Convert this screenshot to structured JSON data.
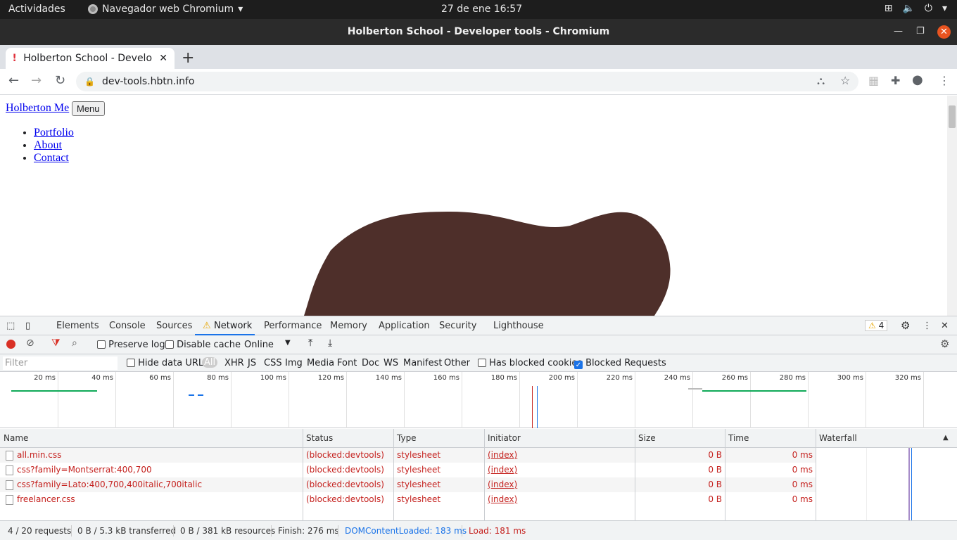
{
  "topbar": {
    "activities": "Actividades",
    "app_menu": "Navegador web Chromium",
    "clock": "27 de ene  16:57"
  },
  "window": {
    "title": "Holberton School - Developer tools - Chromium"
  },
  "browser": {
    "tab_title": "Holberton School - Develo",
    "url": "dev-tools.hbtn.info"
  },
  "page": {
    "brand": "Holberton Me",
    "menu_button": "Menu",
    "nav": [
      "Portfolio",
      "About",
      "Contact"
    ]
  },
  "devtools": {
    "tabs": [
      "Elements",
      "Console",
      "Sources",
      "Network",
      "Performance",
      "Memory",
      "Application",
      "Security",
      "Lighthouse"
    ],
    "active_tab": "Network",
    "warning_count": "4",
    "toolbar": {
      "preserve_log": "Preserve log",
      "disable_cache": "Disable cache",
      "throttling": "Online"
    },
    "filter": {
      "placeholder": "Filter",
      "hide_data_urls": "Hide data URLs",
      "types": [
        "All",
        "XHR",
        "JS",
        "CSS",
        "Img",
        "Media",
        "Font",
        "Doc",
        "WS",
        "Manifest",
        "Other"
      ],
      "has_blocked_cookies": "Has blocked cookies",
      "blocked_requests": "Blocked Requests",
      "blocked_requests_checked": true
    },
    "overview_ticks": [
      "20 ms",
      "40 ms",
      "60 ms",
      "80 ms",
      "100 ms",
      "120 ms",
      "140 ms",
      "160 ms",
      "180 ms",
      "200 ms",
      "220 ms",
      "240 ms",
      "260 ms",
      "280 ms",
      "300 ms",
      "320 ms"
    ],
    "columns": [
      "Name",
      "Status",
      "Type",
      "Initiator",
      "Size",
      "Time",
      "Waterfall"
    ],
    "rows": [
      {
        "name": "all.min.css",
        "status": "(blocked:devtools)",
        "type": "stylesheet",
        "initiator": "(index)",
        "size": "0 B",
        "time": "0 ms"
      },
      {
        "name": "css?family=Montserrat:400,700",
        "status": "(blocked:devtools)",
        "type": "stylesheet",
        "initiator": "(index)",
        "size": "0 B",
        "time": "0 ms"
      },
      {
        "name": "css?family=Lato:400,700,400italic,700italic",
        "status": "(blocked:devtools)",
        "type": "stylesheet",
        "initiator": "(index)",
        "size": "0 B",
        "time": "0 ms"
      },
      {
        "name": "freelancer.css",
        "status": "(blocked:devtools)",
        "type": "stylesheet",
        "initiator": "(index)",
        "size": "0 B",
        "time": "0 ms"
      }
    ],
    "status": {
      "requests": "4 / 20 requests",
      "transferred": "0 B / 5.3 kB transferred",
      "resources": "0 B / 381 kB resources",
      "finish": "Finish: 276 ms",
      "dom_loaded": "DOMContentLoaded: 183 ms",
      "load": "Load: 181 ms"
    }
  },
  "colors": {
    "record": "#d93025",
    "blocked": "#c5221f",
    "dom_loaded": "#1a73e8",
    "load": "#c5221f",
    "blob": "#4e2f2a"
  }
}
